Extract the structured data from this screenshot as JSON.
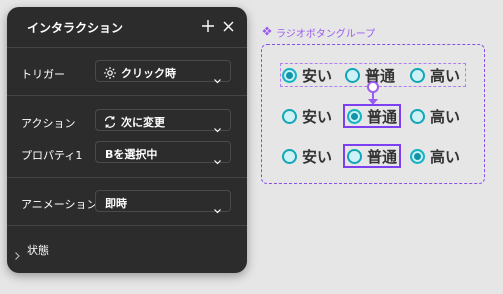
{
  "panel": {
    "title": "インタラクション",
    "trigger": {
      "label": "トリガー",
      "value": "クリック時"
    },
    "action": {
      "label": "アクション",
      "value": "次に変更"
    },
    "property": {
      "label": "プロパティ1",
      "value": "Bを選択中"
    },
    "animation": {
      "label": "アニメーション",
      "value": "即時"
    },
    "state_section": {
      "label": "状態"
    },
    "icons": {
      "add": "plus-icon",
      "close": "close-icon",
      "trigger": "tap-icon",
      "action": "swap-icon",
      "chevron": "chevron-down-icon",
      "expand": "chevron-right-icon"
    }
  },
  "canvas": {
    "group_label": "ラジオボタングループ",
    "group_icon": "component-icon",
    "rows": [
      {
        "options": [
          {
            "label": "安い",
            "checked": true
          },
          {
            "label": "普通",
            "checked": false
          },
          {
            "label": "高い",
            "checked": false
          }
        ]
      },
      {
        "options": [
          {
            "label": "安い",
            "checked": false
          },
          {
            "label": "普通",
            "checked": true
          },
          {
            "label": "高い",
            "checked": false
          }
        ]
      },
      {
        "options": [
          {
            "label": "安い",
            "checked": false
          },
          {
            "label": "普通",
            "checked": false
          },
          {
            "label": "高い",
            "checked": true
          }
        ]
      }
    ]
  },
  "colors": {
    "panel_bg": "#2c2c2c",
    "accent_purple": "#8a4fe8",
    "radio_teal": "#0f94a8",
    "canvas_bg": "#e6e6e6"
  }
}
